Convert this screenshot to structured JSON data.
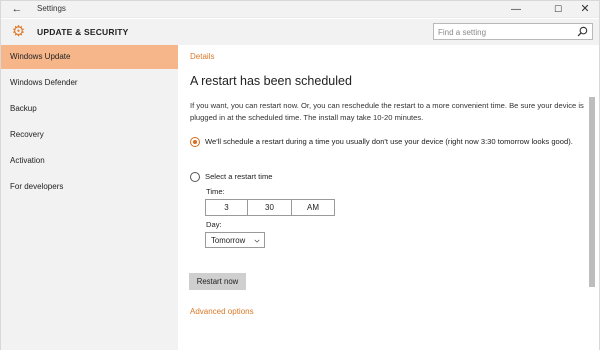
{
  "window": {
    "title": "Settings",
    "back_glyph": "←",
    "minimize_glyph": "—",
    "maximize_glyph": "☐",
    "close_glyph": "✕"
  },
  "header": {
    "section_title": "UPDATE & SECURITY",
    "gear_glyph": "⚙",
    "search_placeholder": "Find a setting",
    "accent_color": "#e07a2c"
  },
  "sidebar": {
    "active_color": "#f6b68a",
    "items": [
      {
        "label": "Windows Update",
        "active": true
      },
      {
        "label": "Windows Defender",
        "active": false
      },
      {
        "label": "Backup",
        "active": false
      },
      {
        "label": "Recovery",
        "active": false
      },
      {
        "label": "Activation",
        "active": false
      },
      {
        "label": "For developers",
        "active": false
      }
    ]
  },
  "main": {
    "details_link": "Details",
    "title": "A restart has been scheduled",
    "description": "If you want, you can restart now. Or, you can reschedule the restart to a more convenient time. Be sure your device is plugged in at the scheduled time. The install may take 10-20 minutes.",
    "option_auto": "We'll schedule a restart during a time you usually don't use your device (right now 3:30 tomorrow looks good).",
    "option_manual": "Select a restart time",
    "time_label": "Time:",
    "time": {
      "hour": "3",
      "minute": "30",
      "ampm": "AM"
    },
    "day_label": "Day:",
    "day_value": "Tomorrow",
    "restart_button": "Restart now",
    "advanced_link": "Advanced options",
    "link_color": "#d97929"
  }
}
